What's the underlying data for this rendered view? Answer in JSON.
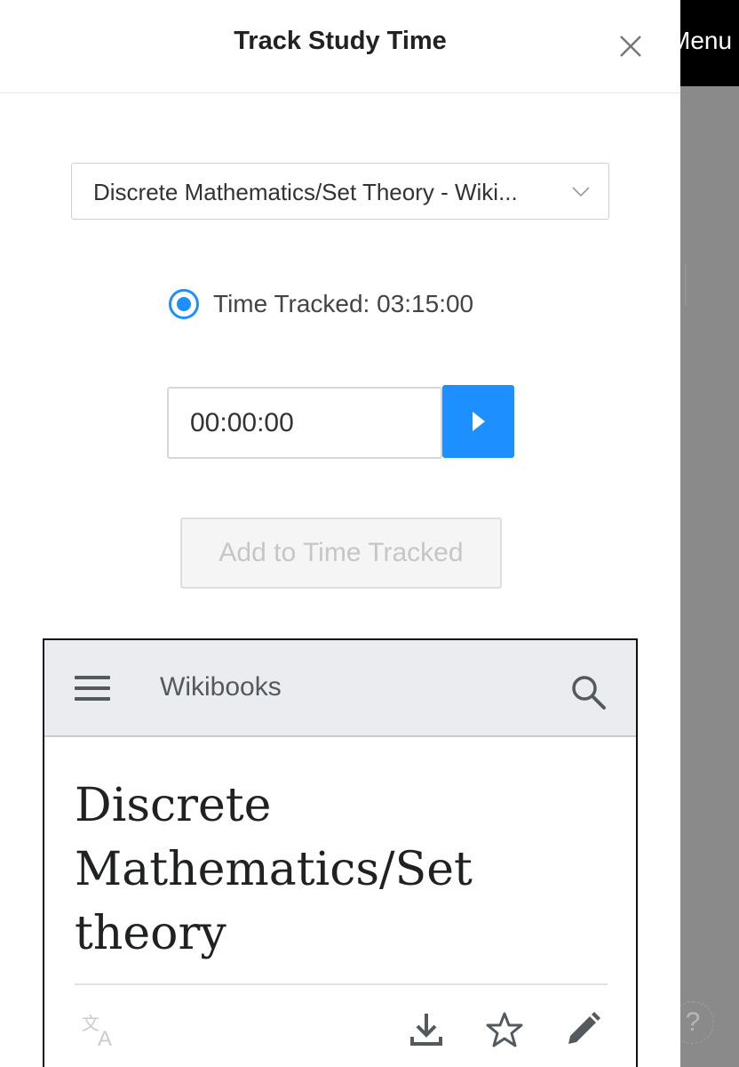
{
  "background": {
    "menu_label": "Menu",
    "help_label": "?"
  },
  "modal": {
    "title": "Track Study Time",
    "close_icon": "close-icon",
    "selected_page": "Discrete Mathematics/Set Theory - Wiki...",
    "radio_label": "Time Tracked: 03:15:00",
    "timer_value": "00:00:00",
    "add_button_label": "Add to Time Tracked",
    "accent_color": "#1e8fff"
  },
  "preview": {
    "site_name": "Wikibooks",
    "page_title": "Discrete Mathematics/Set theory",
    "toolbar_icons": [
      "language-icon",
      "download-icon",
      "star-icon",
      "edit-icon"
    ]
  }
}
